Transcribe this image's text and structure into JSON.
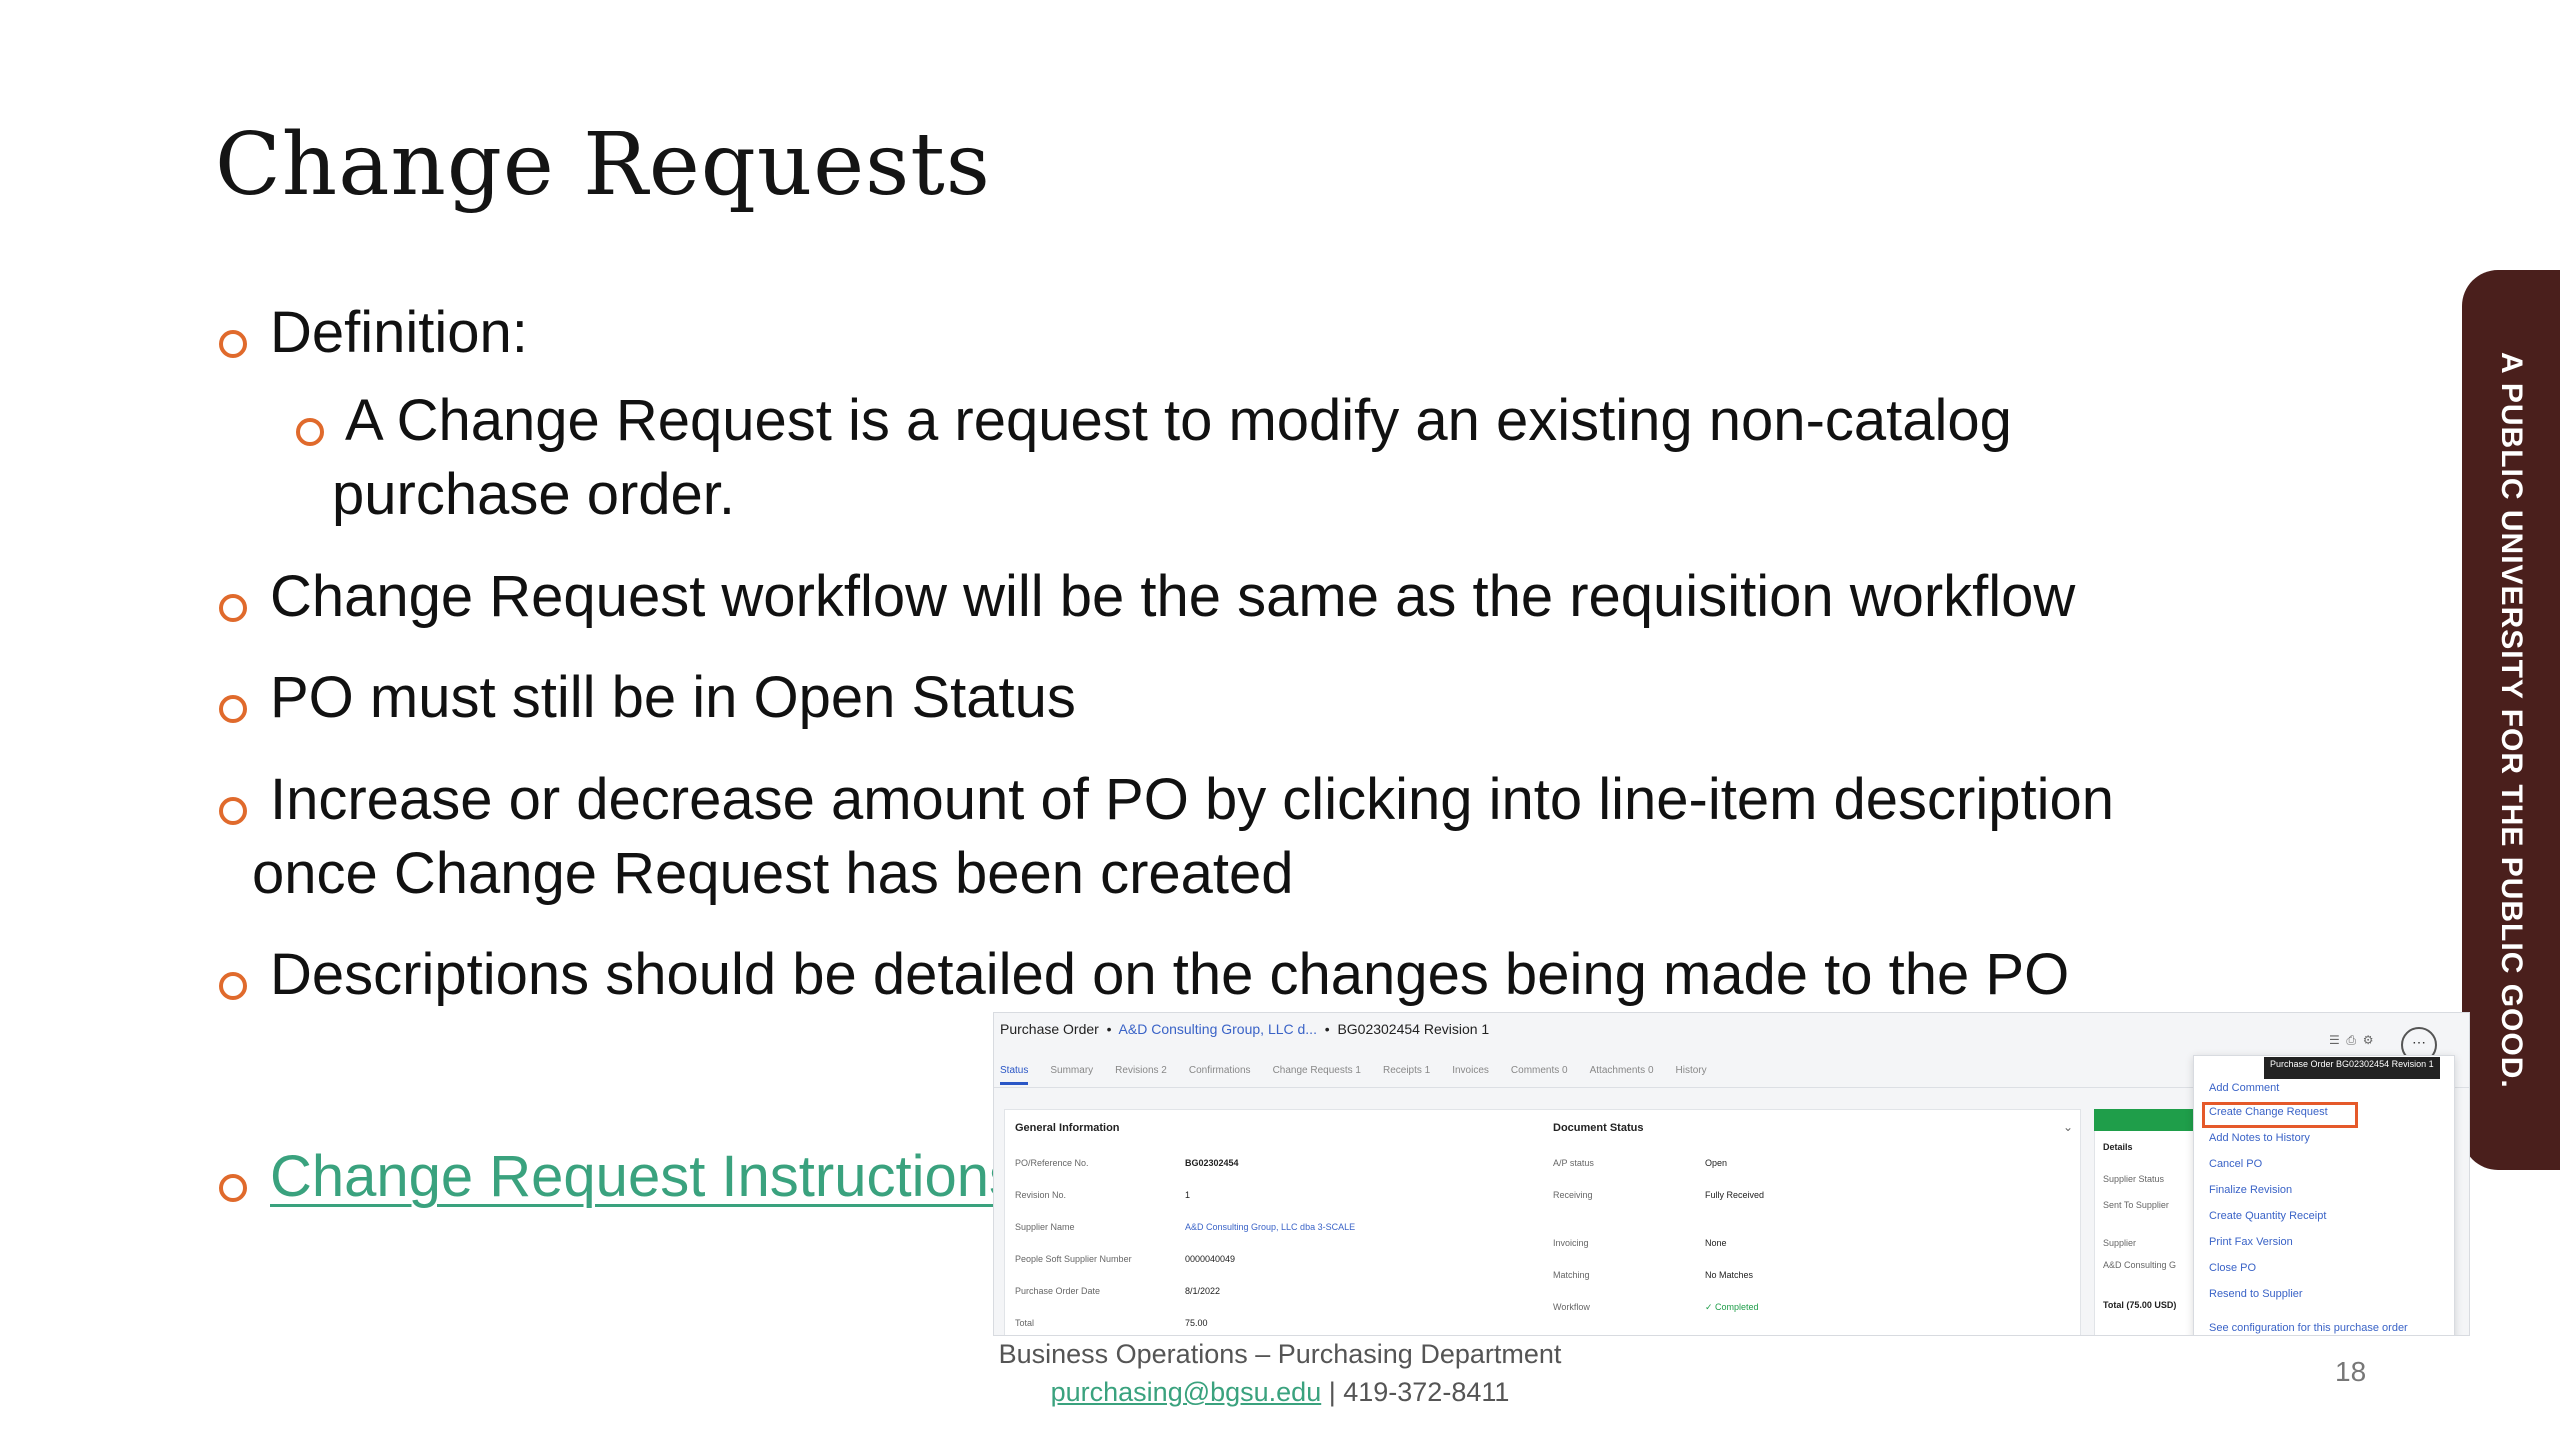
{
  "slide": {
    "title": "Change Requests",
    "bullets": [
      "Definition:",
      "A Change Request is a request to modify an existing non-catalog",
      "purchase order.",
      "Change Request workflow will be the same as the requisition workflow",
      "PO must still be in Open Status",
      "Increase or decrease amount of PO by clicking into line-item description",
      "once Change Request has been created",
      "Descriptions should be detailed on the changes being made to the PO"
    ],
    "link_text": "Change Request Instructions",
    "side_banner": "A PUBLIC UNIVERSITY FOR THE PUBLIC GOOD.",
    "footer_line1": "Business Operations – Purchasing Department",
    "footer_email": "purchasing@bgsu.edu",
    "footer_phone": " | 419-372-8411",
    "page_number": "18",
    "accent_color": "#e06a2c",
    "link_color": "#3aa27e",
    "banner_color": "#4a1f1c"
  },
  "screenshot": {
    "breadcrumb_root": "Purchase Order",
    "breadcrumb_supplier": "A&D Consulting Group, LLC d...",
    "breadcrumb_doc": "BG02302454 Revision 1",
    "tabs": [
      "Status",
      "Summary",
      "Revisions 2",
      "Confirmations",
      "Change Requests 1",
      "Receipts 1",
      "Invoices",
      "Comments 0",
      "Attachments 0",
      "History"
    ],
    "general_title": "General Information",
    "general_fields": [
      {
        "label": "PO/Reference No.",
        "value": "BG02302454"
      },
      {
        "label": "Revision No.",
        "value": "1"
      },
      {
        "label": "Supplier Name",
        "value": "A&D Consulting Group, LLC dba 3-SCALE"
      },
      {
        "label": "People Soft Supplier Number",
        "value": "0000040049"
      },
      {
        "label": "Purchase Order Date",
        "value": "8/1/2022"
      },
      {
        "label": "Total",
        "value": "75.00"
      }
    ],
    "status_title": "Document Status",
    "status_fields": [
      {
        "label": "A/P status",
        "value": "Open"
      },
      {
        "label": "Receiving",
        "value": "Fully Received"
      },
      {
        "label": "Invoicing",
        "value": "None"
      },
      {
        "label": "Matching",
        "value": "No Matches"
      },
      {
        "label": "Workflow",
        "value": "✓ Completed"
      }
    ],
    "details_title": "Details",
    "details_fields": [
      "Supplier Status",
      "Sent To Supplier",
      "Supplier",
      "A&D Consulting G",
      "Total (75.00 USD)"
    ],
    "tooltip": "Purchase Order BG02302454 Revision 1",
    "menu_items": [
      "Add Comment",
      "Create Change Request",
      "Add Notes to History",
      "Cancel PO",
      "Finalize Revision",
      "Create Quantity Receipt",
      "Print Fax Version",
      "Close PO",
      "Resend to Supplier",
      "See configuration for this purchase order"
    ]
  }
}
